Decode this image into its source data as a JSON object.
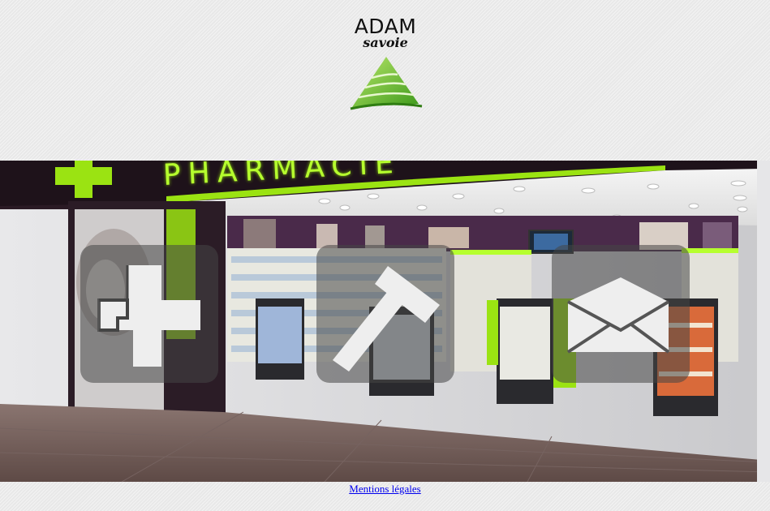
{
  "brand": {
    "name": "ADAM",
    "tagline": "savoie",
    "logo_icon": "green-tree-icon",
    "accent_color": "#7cc924"
  },
  "hero": {
    "storefront_sign": "PHARMACIE",
    "sign_color": "#b6ff2e",
    "tiles": [
      {
        "icon": "pharmacy-cross-icon"
      },
      {
        "icon": "hammer-icon"
      },
      {
        "icon": "envelope-icon"
      }
    ]
  },
  "footer": {
    "legal_link": "Mentions légales"
  }
}
